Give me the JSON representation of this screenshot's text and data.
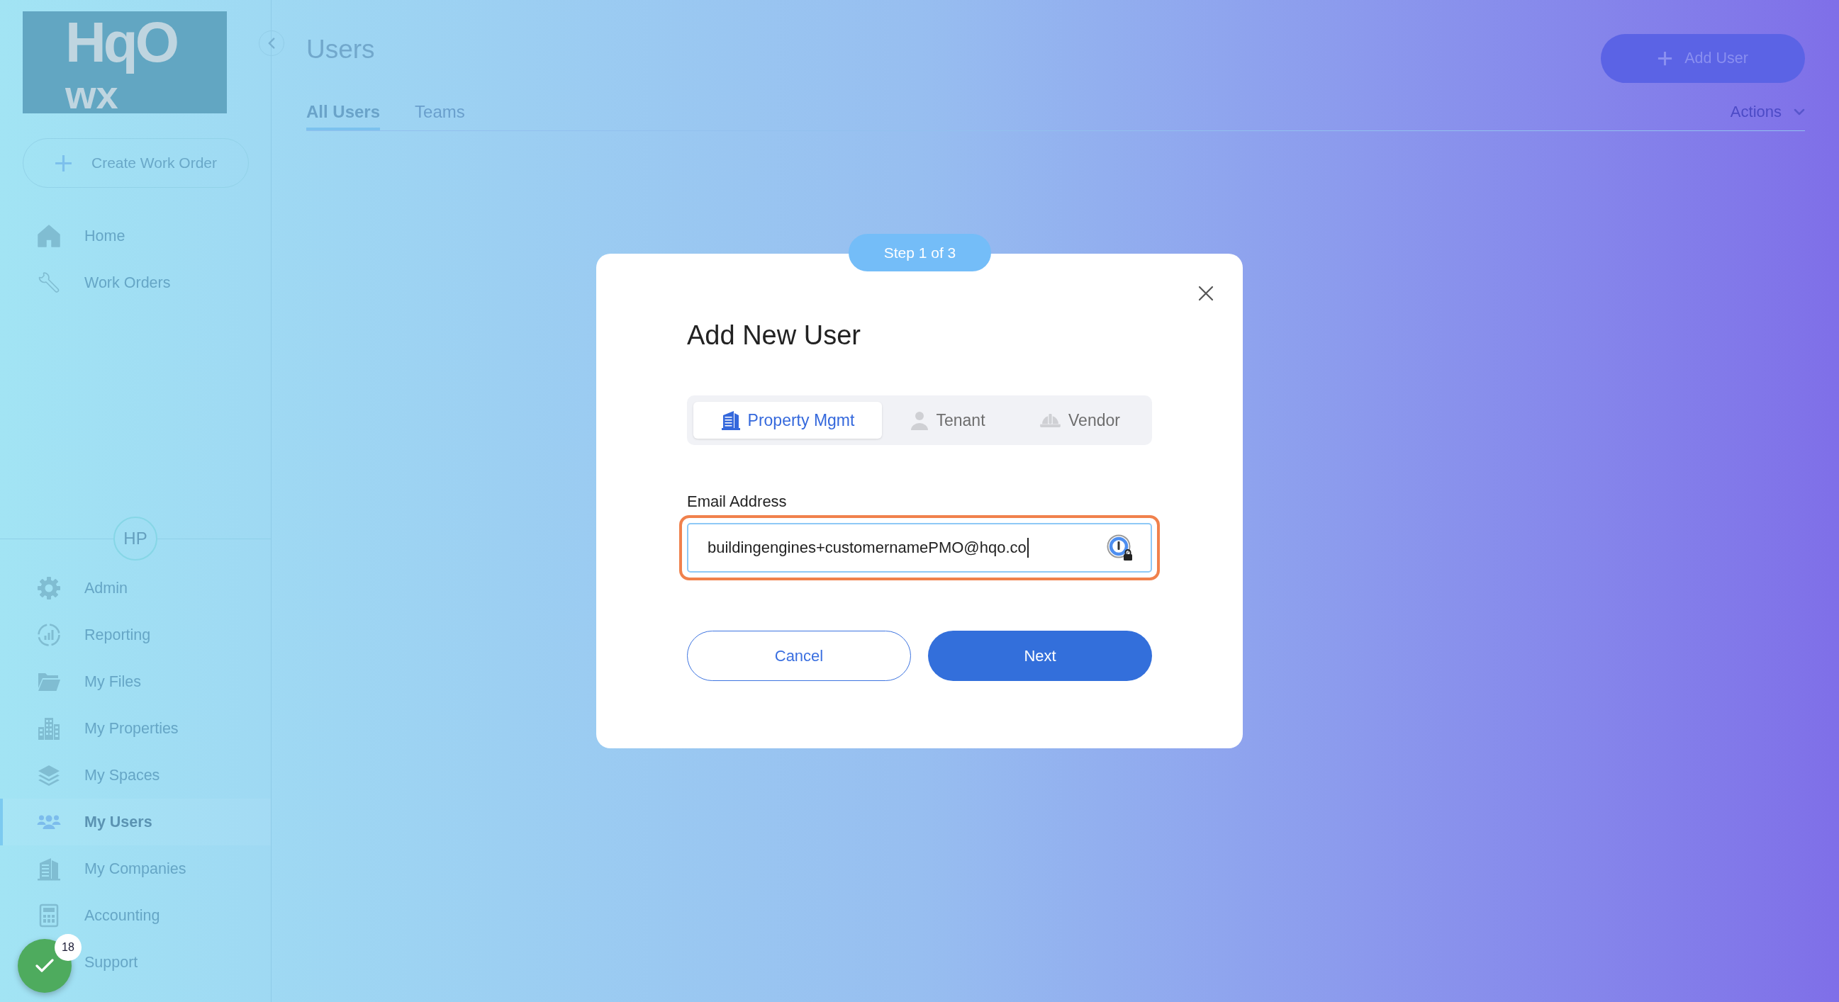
{
  "sidebar": {
    "logo": {
      "line_1": "HqO",
      "line_2": "wx"
    },
    "create_button": {
      "label": "Create Work Order"
    },
    "nav_items": [
      {
        "label": "Home",
        "selected": false
      },
      {
        "label": "Work Orders",
        "selected": false
      }
    ],
    "avatar": {
      "initials": "HP"
    },
    "menu_items": [
      {
        "label": "Admin",
        "selected": false
      },
      {
        "label": "Reporting",
        "selected": false
      },
      {
        "label": "My Files",
        "selected": false
      },
      {
        "label": "My Properties",
        "selected": false
      },
      {
        "label": "My Spaces",
        "selected": false
      },
      {
        "label": "My Users",
        "selected": true
      },
      {
        "label": "My Companies",
        "selected": false
      },
      {
        "label": "Accounting",
        "selected": false
      },
      {
        "label": "Support",
        "selected": false
      }
    ]
  },
  "header": {
    "title": "Users",
    "add_button": {
      "label": "Add User"
    },
    "tabs": [
      {
        "label": "All Users",
        "selected": true
      },
      {
        "label": "Teams",
        "selected": false
      }
    ],
    "actions_menu": {
      "label": "Actions"
    }
  },
  "dialog": {
    "step": "Step 1 of 3",
    "title": "Add New User",
    "user_types": [
      {
        "label": "Property Mgmt",
        "selected": true
      },
      {
        "label": "Tenant",
        "selected": false
      },
      {
        "label": "Vendor",
        "selected": false
      }
    ],
    "email_field": {
      "label": "Email Address",
      "value": "buildingengines+customernamePMO@hqo.co",
      "focused": true
    },
    "buttons": [
      {
        "label": "Cancel",
        "kind": "secondary"
      },
      {
        "label": "Next",
        "kind": "primary"
      }
    ]
  },
  "status_button": {
    "badge": "18"
  }
}
